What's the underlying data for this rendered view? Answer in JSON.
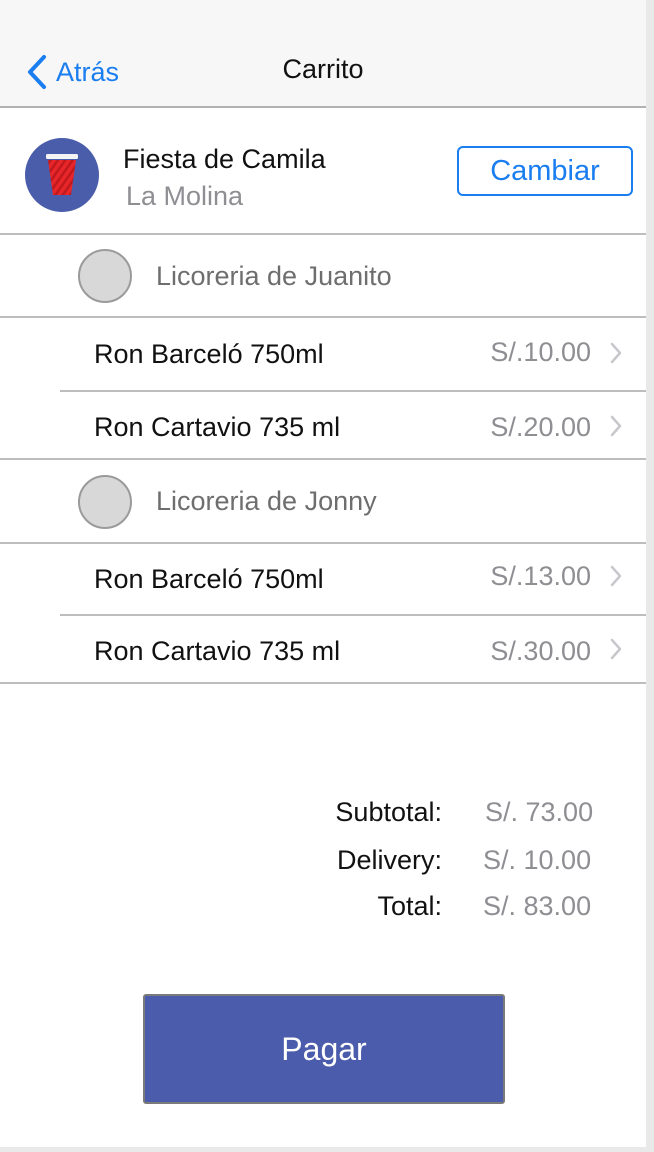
{
  "nav": {
    "back_label": "Atrás",
    "title": "Carrito"
  },
  "event": {
    "name": "Fiesta de Camila",
    "location": "La Molina",
    "change_label": "Cambiar",
    "icon": "party-cup-icon"
  },
  "shops": [
    {
      "name": "Licoreria de Juanito",
      "items": [
        {
          "name": "Ron Barceló 750ml",
          "price": "S/.10.00"
        },
        {
          "name": "Ron Cartavio 735 ml",
          "price": "S/.20.00"
        }
      ]
    },
    {
      "name": "Licoreria de Jonny",
      "items": [
        {
          "name": "Ron Barceló 750ml",
          "price": "S/.13.00"
        },
        {
          "name": "Ron Cartavio 735 ml",
          "price": "S/.30.00"
        }
      ]
    }
  ],
  "totals": {
    "subtotal_label": "Subtotal:",
    "subtotal_value": "S/. 73.00",
    "delivery_label": "Delivery:",
    "delivery_value": "S/. 10.00",
    "total_label": "Total:",
    "total_value": "S/. 83.00"
  },
  "pay_label": "Pagar",
  "colors": {
    "accent": "#1a7ef0",
    "primary": "#4a5cab",
    "cup": "#e8262a"
  }
}
